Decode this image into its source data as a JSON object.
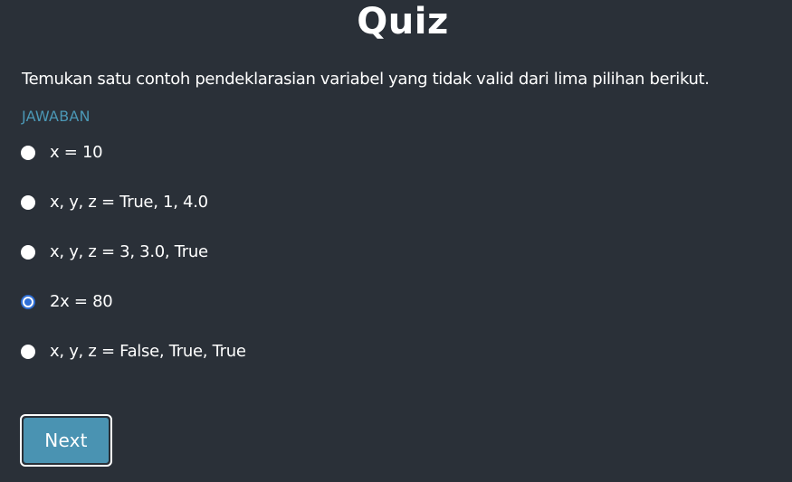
{
  "header": {
    "title": "Quiz"
  },
  "quiz": {
    "question": "Temukan satu contoh pendeklarasian variabel yang tidak valid dari lima pilihan berikut.",
    "answer_label": "JAWABAN",
    "options": [
      {
        "label": "x = 10",
        "selected": false
      },
      {
        "label": "x, y, z = True, 1, 4.0",
        "selected": false
      },
      {
        "label": "x, y, z = 3, 3.0, True",
        "selected": false
      },
      {
        "label": "2x = 80",
        "selected": true
      },
      {
        "label": "x, y, z = False, True, True",
        "selected": false
      }
    ],
    "next_label": "Next"
  },
  "colors": {
    "background": "#2a3038",
    "accent": "#4a93b2",
    "answer_label": "#4b97b5",
    "radio_selected": "#2f6fd6"
  },
  "icons": {
    "radio_unselected": "radio-unchecked-icon",
    "radio_selected": "radio-checked-icon"
  }
}
